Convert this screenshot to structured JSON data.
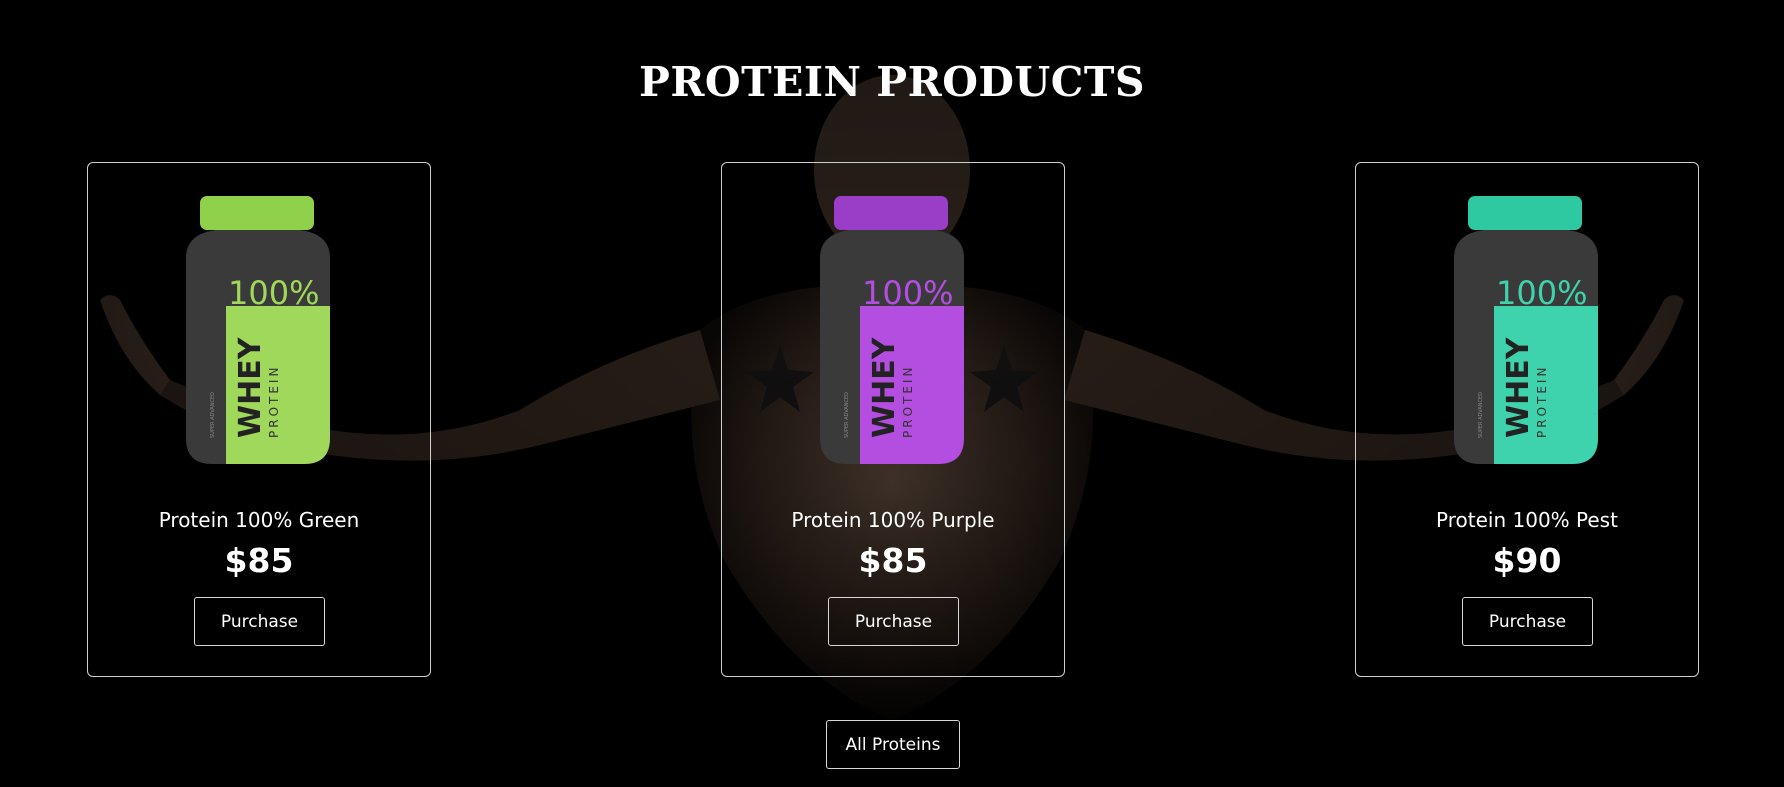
{
  "section": {
    "title": "PROTEIN PRODUCTS"
  },
  "products": [
    {
      "name": "Protein 100% Green",
      "price": "$85",
      "button_label": "Purchase",
      "jar_label_big": "WHEY",
      "jar_label_small": "PROTEIN",
      "jar_label_side": "SUPER ADVANCED",
      "jar_percent": "100%",
      "color": "#9fd85a",
      "cap_color": "#8fd14b"
    },
    {
      "name": "Protein 100% Purple",
      "price": "$85",
      "button_label": "Purchase",
      "jar_label_big": "WHEY",
      "jar_label_small": "PROTEIN",
      "jar_label_side": "SUPER ADVANCED",
      "jar_percent": "100%",
      "color": "#b34ee0",
      "cap_color": "#9a3dc7"
    },
    {
      "name": "Protein 100% Pest",
      "price": "$90",
      "button_label": "Purchase",
      "jar_label_big": "WHEY",
      "jar_label_small": "PROTEIN",
      "jar_label_side": "SUPER ADVANCED",
      "jar_percent": "100%",
      "color": "#3fd3ad",
      "cap_color": "#2ec9a0"
    }
  ],
  "footer": {
    "all_button_label": "All Proteins"
  },
  "colors": {
    "background": "#000000",
    "text": "#ffffff",
    "border": "#cfcfcf"
  }
}
